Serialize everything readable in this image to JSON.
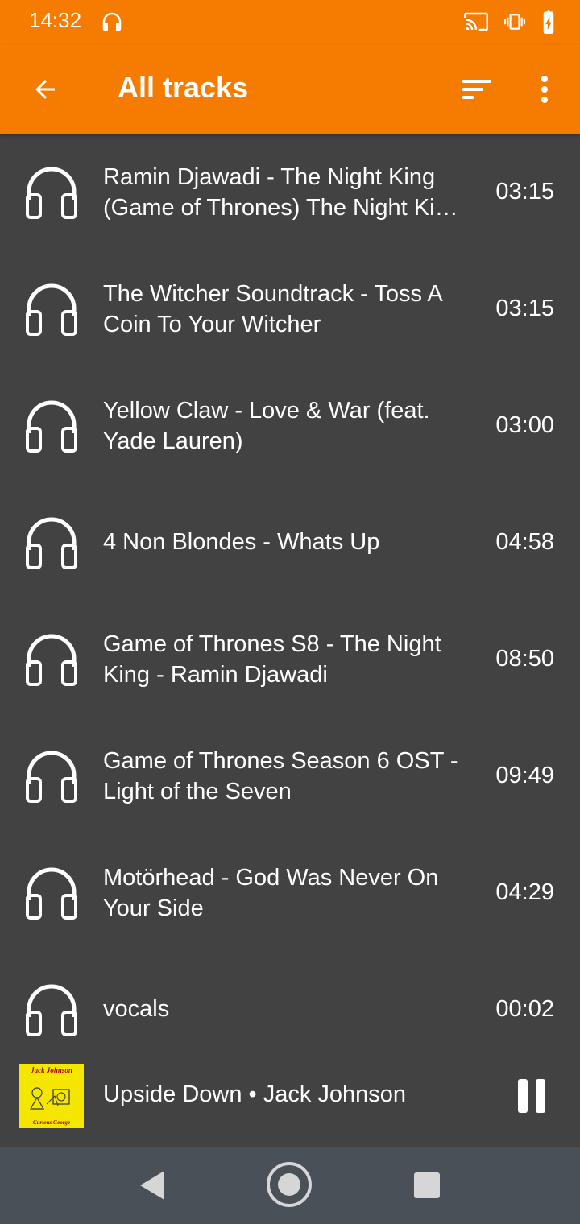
{
  "status_bar": {
    "time": "14:32"
  },
  "app_bar": {
    "title": "All tracks"
  },
  "tracks": [
    {
      "title": "Ramin Djawadi - The Night King (Game of Thrones)  The Night King (Game of Thrones)",
      "duration": "03:15"
    },
    {
      "title": "The Witcher Soundtrack - Toss A Coin To Your Witcher",
      "duration": "03:15"
    },
    {
      "title": "Yellow Claw - Love & War (feat. Yade Lauren)",
      "duration": "03:00"
    },
    {
      "title": "4 Non Blondes - Whats Up",
      "duration": "04:58"
    },
    {
      "title": "Game of Thrones S8 - The Night King - Ramin Djawadi",
      "duration": "08:50"
    },
    {
      "title": "Game of Thrones Season 6 OST - Light of the Seven",
      "duration": "09:49"
    },
    {
      "title": "Motörhead - God Was Never On Your Side",
      "duration": "04:29"
    },
    {
      "title": "vocals",
      "duration": "00:02"
    }
  ],
  "now_playing": {
    "text": "Upside Down • Jack Johnson",
    "album_art_text": "Jack Johnson",
    "album_art_subtext": "Curious George"
  },
  "colors": {
    "accent": "#f57c00",
    "background": "#424242",
    "nav_bar": "#495057"
  }
}
